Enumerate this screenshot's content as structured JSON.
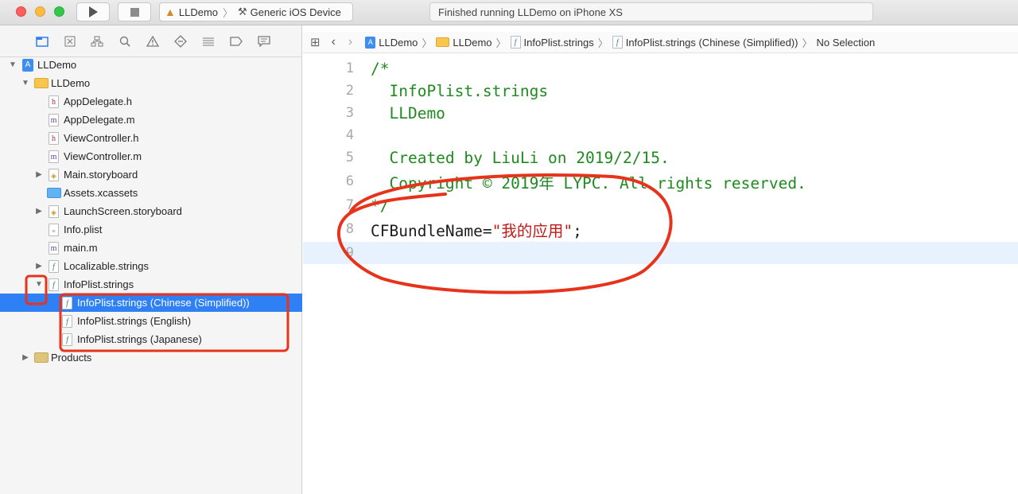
{
  "toolbar": {
    "scheme_target": "LLDemo",
    "scheme_device": "Generic iOS Device",
    "status": "Finished running LLDemo on iPhone XS"
  },
  "navigator": {
    "tree": [
      {
        "label": "LLDemo",
        "type": "project",
        "disclosure": "open"
      },
      {
        "label": "LLDemo",
        "type": "folder",
        "disclosure": "open"
      },
      {
        "label": "AppDelegate.h",
        "type": "h"
      },
      {
        "label": "AppDelegate.m",
        "type": "m"
      },
      {
        "label": "ViewController.h",
        "type": "h"
      },
      {
        "label": "ViewController.m",
        "type": "m"
      },
      {
        "label": "Main.storyboard",
        "type": "storyboard",
        "disclosure": "closed"
      },
      {
        "label": "Assets.xcassets",
        "type": "assets"
      },
      {
        "label": "LaunchScreen.storyboard",
        "type": "storyboard",
        "disclosure": "closed"
      },
      {
        "label": "Info.plist",
        "type": "plist"
      },
      {
        "label": "main.m",
        "type": "m"
      },
      {
        "label": "Localizable.strings",
        "type": "strings",
        "disclosure": "closed"
      },
      {
        "label": "InfoPlist.strings",
        "type": "strings",
        "disclosure": "open"
      },
      {
        "label": "InfoPlist.strings (Chinese (Simplified))",
        "type": "strings",
        "selected": true
      },
      {
        "label": "InfoPlist.strings (English)",
        "type": "strings"
      },
      {
        "label": "InfoPlist.strings (Japanese)",
        "type": "strings"
      },
      {
        "label": "Products",
        "type": "folder",
        "disclosure": "closed"
      }
    ]
  },
  "jumpbar": {
    "crumbs": [
      "LLDemo",
      "LLDemo",
      "InfoPlist.strings",
      "InfoPlist.strings (Chinese (Simplified))",
      "No Selection"
    ]
  },
  "editor": {
    "lines": [
      {
        "n": "1",
        "text": "/*",
        "kind": "comment"
      },
      {
        "n": "2",
        "text": "  InfoPlist.strings",
        "kind": "comment"
      },
      {
        "n": "3",
        "text": "  LLDemo",
        "kind": "comment"
      },
      {
        "n": "4",
        "text": "",
        "kind": "comment"
      },
      {
        "n": "5",
        "text": "  Created by LiuLi on 2019/2/15.",
        "kind": "comment"
      },
      {
        "n": "6",
        "text": "  Copyright © 2019年 LYPC. All rights reserved.",
        "kind": "comment"
      },
      {
        "n": "7",
        "text": "*/",
        "kind": "comment"
      },
      {
        "n": "8",
        "key": "CFBundleName=",
        "value": "\"我的应用\"",
        "tail": ";",
        "kind": "code"
      },
      {
        "n": "9",
        "text": "",
        "kind": "code"
      }
    ]
  },
  "colors": {
    "selection": "#2f7ff5",
    "comment": "#1f8a1f",
    "string": "#c41a16",
    "annotation": "#e8331c"
  }
}
